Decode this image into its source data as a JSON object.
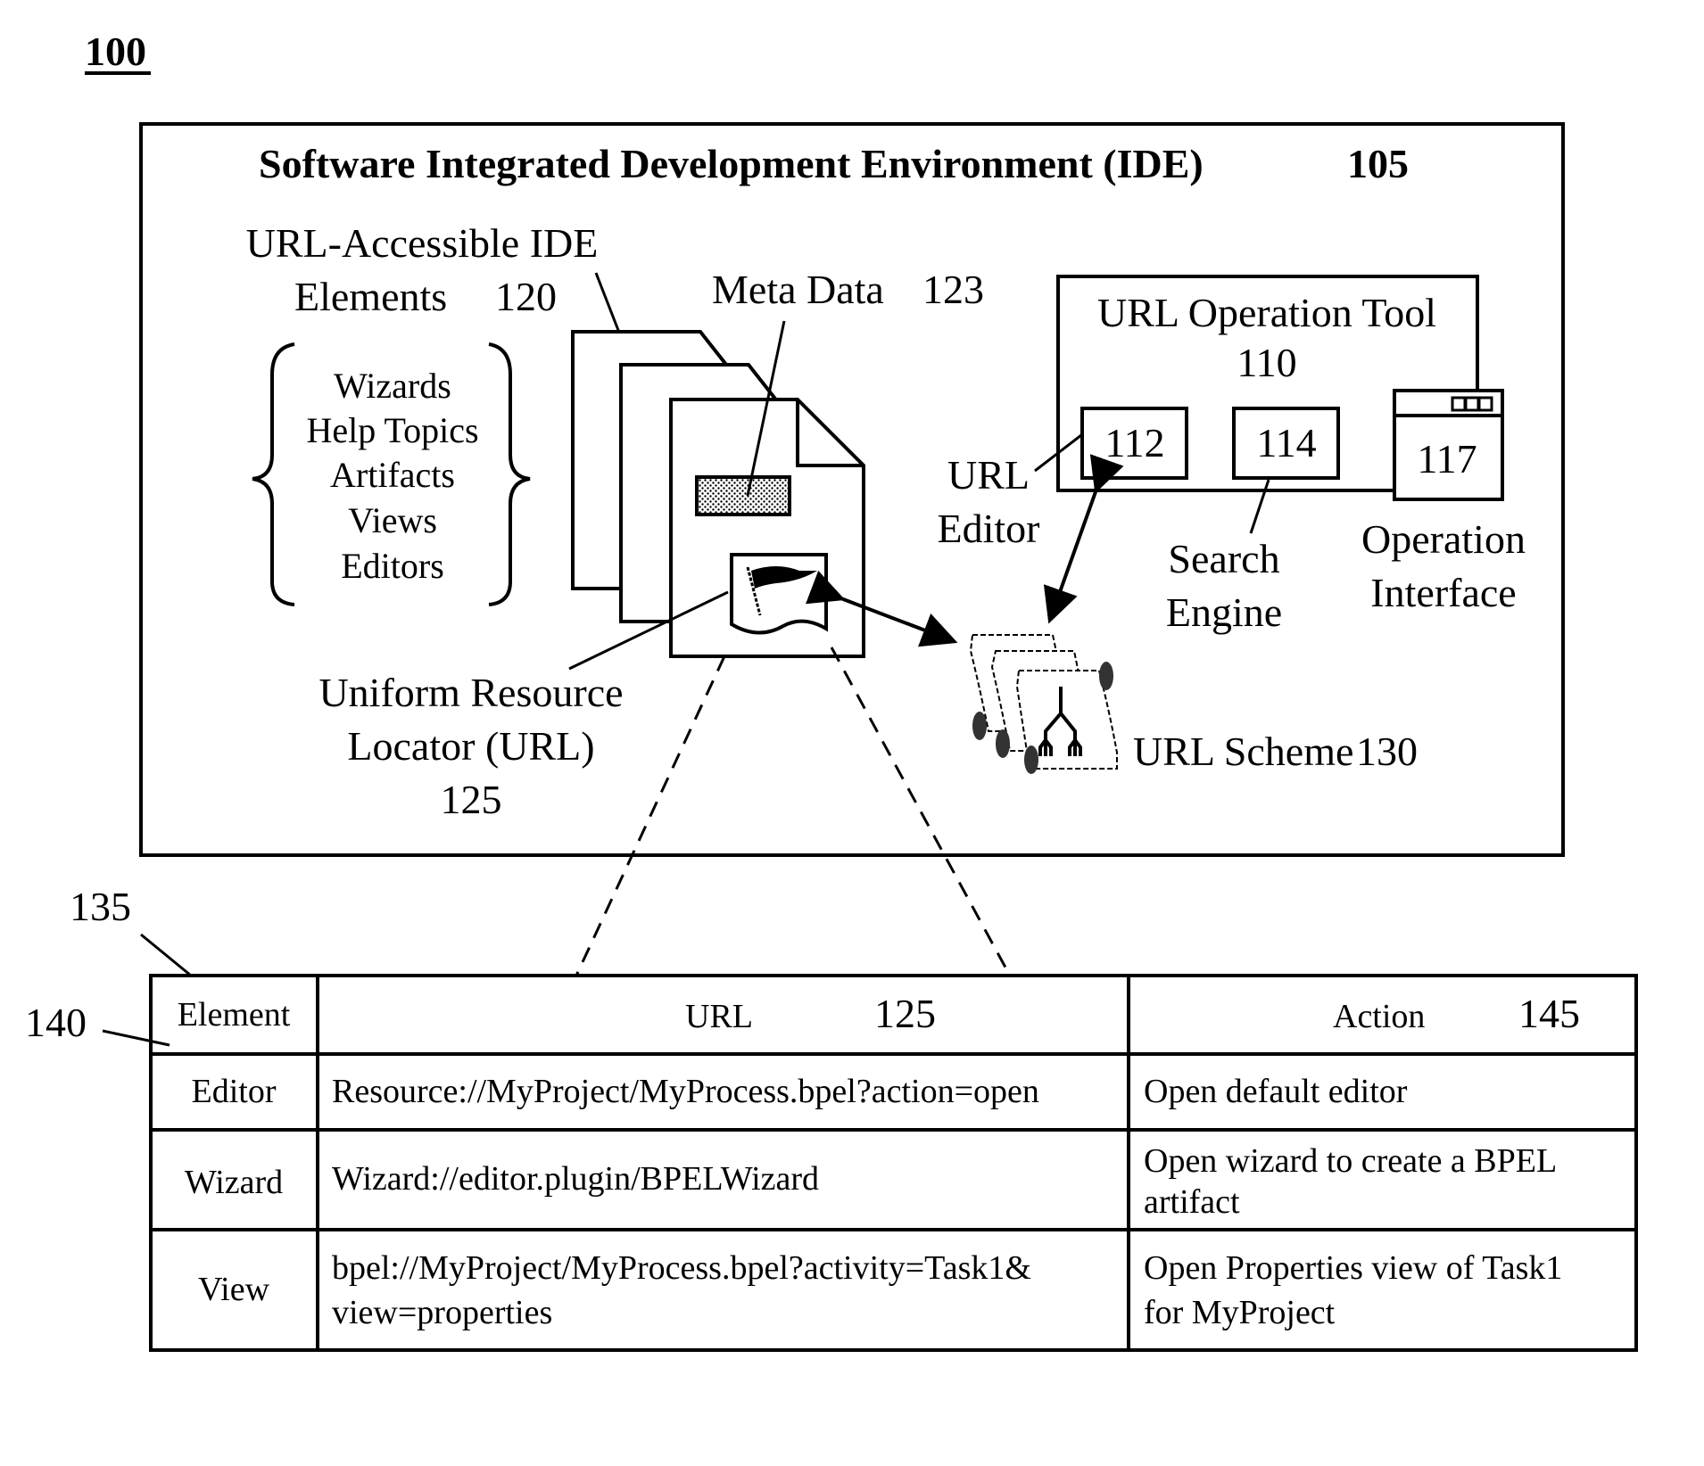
{
  "figure": {
    "label": "100",
    "ide": {
      "title": "Software Integrated Development Environment (IDE)",
      "ref": "105"
    },
    "elements": {
      "label_line1": "URL-Accessible IDE",
      "label_line2": "Elements",
      "ref": "120",
      "list": [
        "Wizards",
        "Help Topics",
        "Artifacts",
        "Views",
        "Editors"
      ]
    },
    "metadata": {
      "label": "Meta Data",
      "ref": "123"
    },
    "url": {
      "line1": "Uniform Resource",
      "line2": "Locator (URL)",
      "ref": "125"
    },
    "tool": {
      "label": "URL Operation Tool",
      "ref": "110",
      "url_editor": {
        "ref": "112",
        "line1": "URL",
        "line2": "Editor"
      },
      "search_engine": {
        "ref": "114",
        "line1": "Search",
        "line2": "Engine"
      },
      "operation_interface": {
        "ref": "117",
        "line1": "Operation",
        "line2": "Interface"
      }
    },
    "scheme": {
      "label": "URL Scheme",
      "ref": "130"
    },
    "table": {
      "ref": "135",
      "header_ref": "140",
      "headers": [
        {
          "label": "Element",
          "ref": ""
        },
        {
          "label": "URL",
          "ref": "125"
        },
        {
          "label": "Action",
          "ref": "145"
        }
      ],
      "rows": [
        {
          "element": "Editor",
          "url": [
            "Resource://MyProject/MyProcess.bpel?action=open"
          ],
          "action": [
            "Open default editor"
          ]
        },
        {
          "element": "Wizard",
          "url": [
            "Wizard://editor.plugin/BPELWizard"
          ],
          "action": [
            "Open wizard to create a BPEL",
            "artifact"
          ]
        },
        {
          "element": "View",
          "url": [
            "bpel://MyProject/MyProcess.bpel?activity=Task1&",
            "view=properties"
          ],
          "action": [
            "Open Properties view of Task1",
            "for MyProject"
          ]
        }
      ]
    }
  }
}
